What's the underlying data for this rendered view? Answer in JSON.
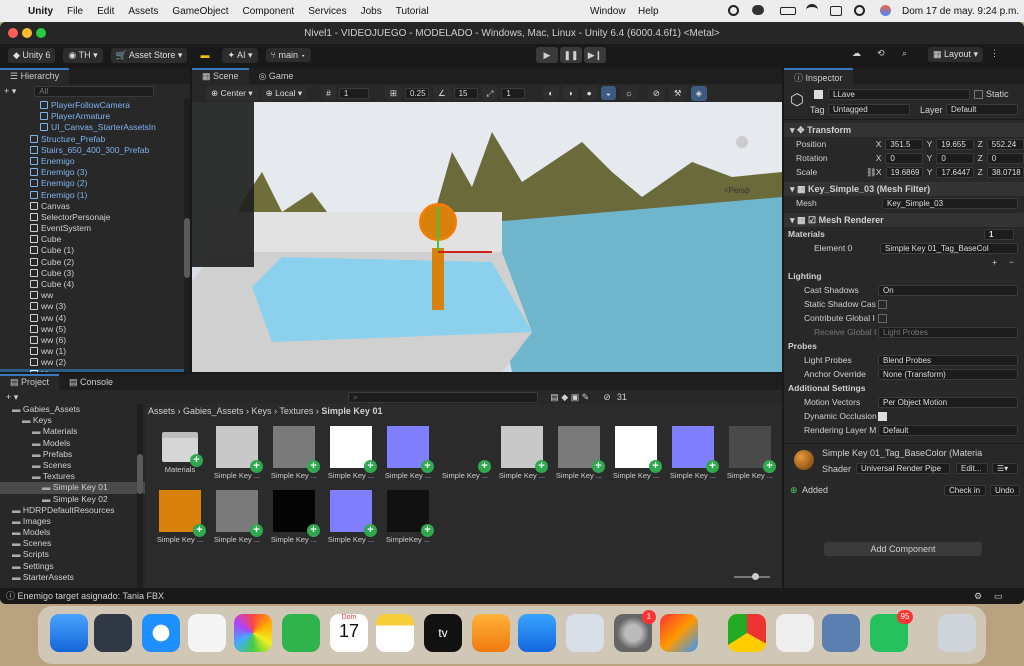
{
  "menubar": {
    "apple": "",
    "app": "Unity",
    "items": [
      "File",
      "Edit",
      "Assets",
      "GameObject",
      "Component",
      "Services",
      "Jobs",
      "Tutorial"
    ],
    "right_items": [
      "Window",
      "Help"
    ],
    "datetime": "Dom 17 de may.  9:24 p.m."
  },
  "window": {
    "title": "Nivel1 - VIDEOJUEGO - MODELADO - Windows, Mac, Linux - Unity 6.4 (6000.4.6f1) <Metal>"
  },
  "toolbar": {
    "unity_label": "Unity 6",
    "account": "TH",
    "asset_store": "Asset Store",
    "ai": "AI",
    "branch": "main",
    "layout": "Layout"
  },
  "hierarchy": {
    "tab": "Hierarchy",
    "search_placeholder": "All",
    "items": [
      {
        "label": "PlayerFollowCamera",
        "cls": "blue",
        "indent": 4
      },
      {
        "label": "PlayerArmature",
        "cls": "blue",
        "indent": 4
      },
      {
        "label": "UI_Canvas_StarterAssetsIn",
        "cls": "blue",
        "indent": 4
      },
      {
        "label": "Structure_Prefab",
        "cls": "blue",
        "indent": 3
      },
      {
        "label": "Stairs_650_400_300_Prefab",
        "cls": "blue",
        "indent": 3
      },
      {
        "label": "Enemigo",
        "cls": "blue",
        "indent": 3
      },
      {
        "label": "Enemigo (3)",
        "cls": "blue",
        "indent": 3
      },
      {
        "label": "Enemigo (2)",
        "cls": "blue",
        "indent": 3
      },
      {
        "label": "Enemigo (1)",
        "cls": "blue",
        "indent": 3
      },
      {
        "label": "Canvas",
        "cls": "",
        "indent": 3
      },
      {
        "label": "SelectorPersonaje",
        "cls": "",
        "indent": 3
      },
      {
        "label": "EventSystem",
        "cls": "",
        "indent": 3
      },
      {
        "label": "Cube",
        "cls": "",
        "indent": 3
      },
      {
        "label": "Cube (1)",
        "cls": "",
        "indent": 3
      },
      {
        "label": "Cube (2)",
        "cls": "",
        "indent": 3
      },
      {
        "label": "Cube (3)",
        "cls": "",
        "indent": 3
      },
      {
        "label": "Cube (4)",
        "cls": "",
        "indent": 3
      },
      {
        "label": "ww",
        "cls": "",
        "indent": 3
      },
      {
        "label": "ww (3)",
        "cls": "",
        "indent": 3
      },
      {
        "label": "ww (4)",
        "cls": "",
        "indent": 3
      },
      {
        "label": "ww (5)",
        "cls": "",
        "indent": 3
      },
      {
        "label": "ww (6)",
        "cls": "",
        "indent": 3
      },
      {
        "label": "ww (1)",
        "cls": "",
        "indent": 3
      },
      {
        "label": "ww (2)",
        "cls": "",
        "indent": 3
      },
      {
        "label": "LLave",
        "cls": "sel",
        "indent": 3
      }
    ]
  },
  "scene": {
    "tabs": [
      "Scene",
      "Game"
    ],
    "pivot": "Center",
    "space": "Local",
    "grid_num": "1",
    "snap": "0.25",
    "angle": "15",
    "scale": "1",
    "persp": "<Persp"
  },
  "project": {
    "tabs": [
      "Project",
      "Console"
    ],
    "breadcrumb": [
      "Assets",
      "Gabies_Assets",
      "Keys",
      "Textures",
      "Simple Key 01"
    ],
    "count": "31",
    "tree": [
      {
        "label": "Gabies_Assets",
        "indent": 1
      },
      {
        "label": "Keys",
        "indent": 2
      },
      {
        "label": "Materials",
        "indent": 3
      },
      {
        "label": "Models",
        "indent": 3
      },
      {
        "label": "Prefabs",
        "indent": 3
      },
      {
        "label": "Scenes",
        "indent": 3
      },
      {
        "label": "Textures",
        "indent": 3
      },
      {
        "label": "Simple Key 01",
        "indent": 4
      },
      {
        "label": "Simple Key 02",
        "indent": 4
      },
      {
        "label": "HDRPDefaultResources",
        "indent": 1
      },
      {
        "label": "Images",
        "indent": 1
      },
      {
        "label": "Models",
        "indent": 1
      },
      {
        "label": "Scenes",
        "indent": 1
      },
      {
        "label": "Scripts",
        "indent": 1
      },
      {
        "label": "Settings",
        "indent": 1
      },
      {
        "label": "StarterAssets",
        "indent": 1
      }
    ],
    "assets": [
      {
        "label": "Materials",
        "color": "folder"
      },
      {
        "label": "Simple Key ...",
        "color": "#c8c8c8"
      },
      {
        "label": "Simple Key ...",
        "color": "#7a7a7a"
      },
      {
        "label": "Simple Key ...",
        "color": "#ffffff"
      },
      {
        "label": "Simple Key ...",
        "color": "#7f7fff"
      },
      {
        "label": "Simple Key ...",
        "color": "#2b2b2b"
      },
      {
        "label": "Simple Key ...",
        "color": "#c8c8c8"
      },
      {
        "label": "Simple Key ...",
        "color": "#7a7a7a"
      },
      {
        "label": "Simple Key ...",
        "color": "#ffffff"
      },
      {
        "label": "Simple Key ...",
        "color": "#7f7fff"
      },
      {
        "label": "Simple Key ...",
        "color": "#4a4a4a"
      },
      {
        "label": "Simple Key ...",
        "color": "#d8820b"
      },
      {
        "label": "Simple Key ...",
        "color": "#7a7a7a"
      },
      {
        "label": "Simple Key ...",
        "color": "#050505"
      },
      {
        "label": "Simple Key ...",
        "color": "#7f7fff"
      },
      {
        "label": "SimpleKey ...",
        "color": "#111111"
      }
    ]
  },
  "inspector": {
    "tab": "Inspector",
    "name": "LLave",
    "static": "Static",
    "tag_label": "Tag",
    "tag": "Untagged",
    "layer_label": "Layer",
    "layer": "Default",
    "transform": {
      "title": "Transform",
      "position": [
        "351.5",
        "19.655",
        "552.24"
      ],
      "rotation": [
        "0",
        "0",
        "0"
      ],
      "scale": [
        "19.6869",
        "17.6447",
        "38.0718"
      ],
      "labels": [
        "Position",
        "Rotation",
        "Scale"
      ]
    },
    "mesh_filter": {
      "title": "Key_Simple_03 (Mesh Filter)",
      "mesh_label": "Mesh",
      "mesh": "Key_Simple_03"
    },
    "mesh_renderer": {
      "title": "Mesh Renderer",
      "materials_label": "Materials",
      "materials_count": "1",
      "element_label": "Element 0",
      "element": "Simple Key 01_Tag_BaseCol",
      "lighting": "Lighting",
      "cast_shadows_label": "Cast Shadows",
      "cast_shadows": "On",
      "static_shadow": "Static Shadow Cas",
      "contribute_gi": "Contribute Global I",
      "receive_gi": "Receive Global I",
      "receive_gi_value": "Light Probes",
      "probes": "Probes",
      "light_probes_label": "Light Probes",
      "light_probes": "Blend Probes",
      "anchor_label": "Anchor Override",
      "anchor": "None (Transform)",
      "additional": "Additional Settings",
      "motion_label": "Motion Vectors",
      "motion": "Per Object Motion",
      "dynamic_occl": "Dynamic Occlusion",
      "rendering_layer_label": "Rendering Layer M",
      "rendering_layer": "Default"
    },
    "material": {
      "name": "Simple Key 01_Tag_BaseColor (Materia",
      "shader_label": "Shader",
      "shader": "Universal Render Pipe",
      "edit": "Edit...",
      "added": "Added",
      "check_in": "Check in",
      "undo": "Undo"
    },
    "add_component": "Add Component"
  },
  "status": {
    "text": "Enemigo target asignado: Tania FBX"
  },
  "dock": {
    "date_day": "Dom",
    "date_num": "17",
    "badge_settings": "1",
    "badge_whatsapp": "95",
    "tv": "tv"
  }
}
